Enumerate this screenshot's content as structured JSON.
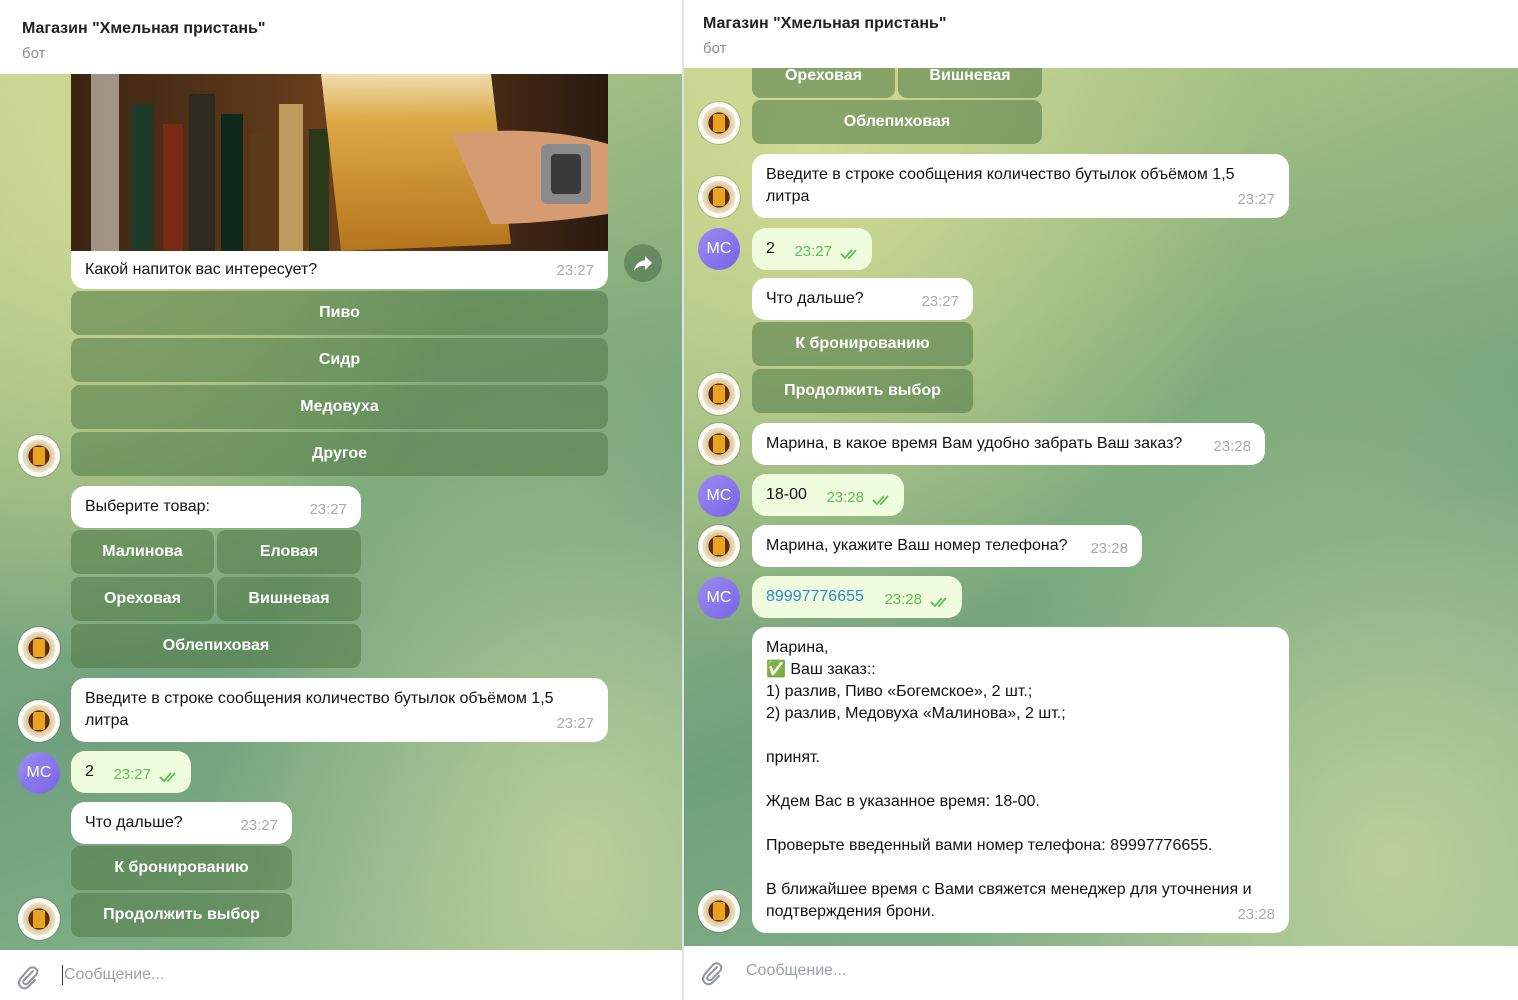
{
  "app": {
    "title": "Магазин \"Хмельная пристань\"",
    "subtitle": "бот",
    "composer_placeholder": "Сообщение..."
  },
  "avatars": {
    "user_initials": "МС"
  },
  "colors": {
    "bubble_out": "#effdde",
    "bubble_in": "#ffffff",
    "keyboard_button": "#5a8a50",
    "read_ticks": "#5fbf52",
    "link": "#2d8ac9",
    "user_avatar": "#8b78ec"
  },
  "left": {
    "drink_question": {
      "text": "Какой напиток вас интересует?",
      "time": "23:27"
    },
    "drink_buttons": [
      "Пиво",
      "Сидр",
      "Медовуха",
      "Другое"
    ],
    "product_prompt": {
      "text": "Выберите товар:",
      "time": "23:27"
    },
    "product_buttons": [
      "Малинова",
      "Еловая",
      "Ореховая",
      "Вишневая",
      "Облепиховая"
    ],
    "qty_prompt": {
      "text": "Введите в строке сообщения количество бутылок объёмом 1,5 литра",
      "time": "23:27"
    },
    "qty_answer": {
      "text": "2",
      "time": "23:27"
    },
    "next_prompt": {
      "text": "Что дальше?",
      "time": "23:27"
    },
    "next_buttons": [
      "К бронированию",
      "Продолжить выбор"
    ]
  },
  "right": {
    "product_buttons_partial": [
      "Ореховая",
      "Вишневая",
      "Облепиховая"
    ],
    "qty_prompt": {
      "text": "Введите в строке сообщения количество бутылок объёмом 1,5 литра",
      "time": "23:27"
    },
    "qty_answer": {
      "text": "2",
      "time": "23:27"
    },
    "next_prompt": {
      "text": "Что дальше?",
      "time": "23:27"
    },
    "next_buttons": [
      "К бронированию",
      "Продолжить выбор"
    ],
    "time_question": {
      "text": "Марина, в какое время Вам удобно забрать Ваш заказ?",
      "time": "23:28"
    },
    "time_answer": {
      "text": "18-00",
      "time": "23:28"
    },
    "phone_question": {
      "text": "Марина, укажите Ваш номер телефона?",
      "time": "23:28"
    },
    "phone_answer": {
      "text": "89997776655",
      "time": "23:28"
    },
    "order_summary": {
      "text": "Марина,\n✅ Ваш заказ::\n1) разлив, Пиво «Богемское», 2 шт.;\n2) разлив, Медовуха «Малинова», 2 шт.;\n\nпринят.\n\nЖдем Вас в указанное время: 18-00.\n\nПроверьте введенный вами номер телефона: 89997776655.\n\nВ ближайшее время с Вами свяжется менеджер для уточнения и подтверждения брони.",
      "time": "23:28"
    }
  }
}
